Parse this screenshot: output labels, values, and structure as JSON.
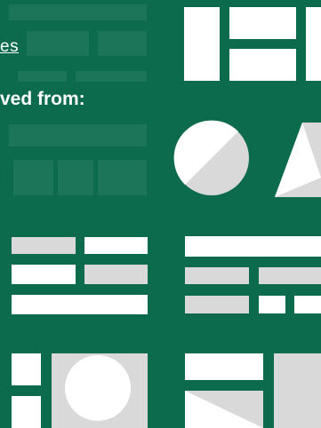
{
  "text": {
    "link_fragment": "es",
    "retrieved_label": "ved from:"
  },
  "colors": {
    "background": "#0b6b4c",
    "tile_white": "#ffffff",
    "tile_gray": "#d9d9d9"
  },
  "icons": [
    "layout-grid-icon",
    "circle-triangle-icon",
    "text-lines-icon",
    "table-rows-icon",
    "image-card-icon",
    "image-text-icon"
  ]
}
